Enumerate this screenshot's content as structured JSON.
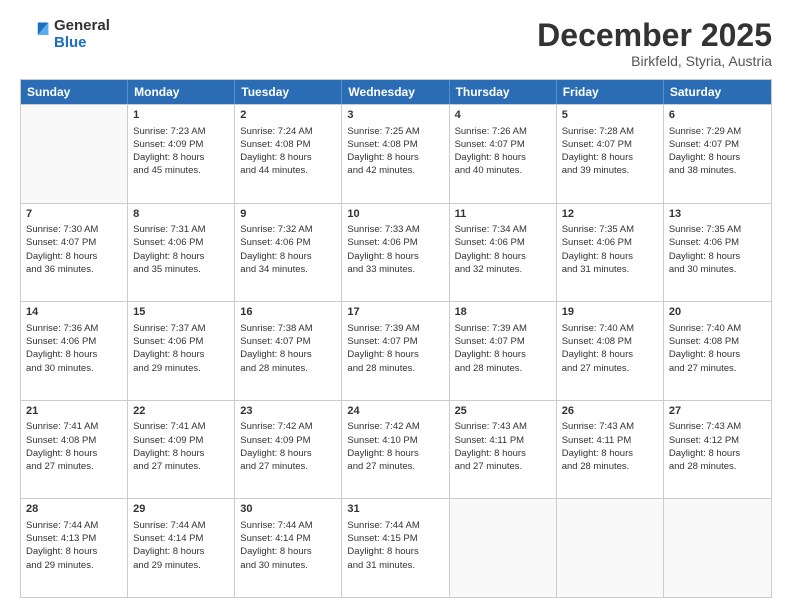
{
  "logo": {
    "general": "General",
    "blue": "Blue"
  },
  "title": "December 2025",
  "subtitle": "Birkfeld, Styria, Austria",
  "days": [
    "Sunday",
    "Monday",
    "Tuesday",
    "Wednesday",
    "Thursday",
    "Friday",
    "Saturday"
  ],
  "weeks": [
    [
      {
        "day": "",
        "lines": []
      },
      {
        "day": "1",
        "lines": [
          "Sunrise: 7:23 AM",
          "Sunset: 4:09 PM",
          "Daylight: 8 hours",
          "and 45 minutes."
        ]
      },
      {
        "day": "2",
        "lines": [
          "Sunrise: 7:24 AM",
          "Sunset: 4:08 PM",
          "Daylight: 8 hours",
          "and 44 minutes."
        ]
      },
      {
        "day": "3",
        "lines": [
          "Sunrise: 7:25 AM",
          "Sunset: 4:08 PM",
          "Daylight: 8 hours",
          "and 42 minutes."
        ]
      },
      {
        "day": "4",
        "lines": [
          "Sunrise: 7:26 AM",
          "Sunset: 4:07 PM",
          "Daylight: 8 hours",
          "and 40 minutes."
        ]
      },
      {
        "day": "5",
        "lines": [
          "Sunrise: 7:28 AM",
          "Sunset: 4:07 PM",
          "Daylight: 8 hours",
          "and 39 minutes."
        ]
      },
      {
        "day": "6",
        "lines": [
          "Sunrise: 7:29 AM",
          "Sunset: 4:07 PM",
          "Daylight: 8 hours",
          "and 38 minutes."
        ]
      }
    ],
    [
      {
        "day": "7",
        "lines": [
          "Sunrise: 7:30 AM",
          "Sunset: 4:07 PM",
          "Daylight: 8 hours",
          "and 36 minutes."
        ]
      },
      {
        "day": "8",
        "lines": [
          "Sunrise: 7:31 AM",
          "Sunset: 4:06 PM",
          "Daylight: 8 hours",
          "and 35 minutes."
        ]
      },
      {
        "day": "9",
        "lines": [
          "Sunrise: 7:32 AM",
          "Sunset: 4:06 PM",
          "Daylight: 8 hours",
          "and 34 minutes."
        ]
      },
      {
        "day": "10",
        "lines": [
          "Sunrise: 7:33 AM",
          "Sunset: 4:06 PM",
          "Daylight: 8 hours",
          "and 33 minutes."
        ]
      },
      {
        "day": "11",
        "lines": [
          "Sunrise: 7:34 AM",
          "Sunset: 4:06 PM",
          "Daylight: 8 hours",
          "and 32 minutes."
        ]
      },
      {
        "day": "12",
        "lines": [
          "Sunrise: 7:35 AM",
          "Sunset: 4:06 PM",
          "Daylight: 8 hours",
          "and 31 minutes."
        ]
      },
      {
        "day": "13",
        "lines": [
          "Sunrise: 7:35 AM",
          "Sunset: 4:06 PM",
          "Daylight: 8 hours",
          "and 30 minutes."
        ]
      }
    ],
    [
      {
        "day": "14",
        "lines": [
          "Sunrise: 7:36 AM",
          "Sunset: 4:06 PM",
          "Daylight: 8 hours",
          "and 30 minutes."
        ]
      },
      {
        "day": "15",
        "lines": [
          "Sunrise: 7:37 AM",
          "Sunset: 4:06 PM",
          "Daylight: 8 hours",
          "and 29 minutes."
        ]
      },
      {
        "day": "16",
        "lines": [
          "Sunrise: 7:38 AM",
          "Sunset: 4:07 PM",
          "Daylight: 8 hours",
          "and 28 minutes."
        ]
      },
      {
        "day": "17",
        "lines": [
          "Sunrise: 7:39 AM",
          "Sunset: 4:07 PM",
          "Daylight: 8 hours",
          "and 28 minutes."
        ]
      },
      {
        "day": "18",
        "lines": [
          "Sunrise: 7:39 AM",
          "Sunset: 4:07 PM",
          "Daylight: 8 hours",
          "and 28 minutes."
        ]
      },
      {
        "day": "19",
        "lines": [
          "Sunrise: 7:40 AM",
          "Sunset: 4:08 PM",
          "Daylight: 8 hours",
          "and 27 minutes."
        ]
      },
      {
        "day": "20",
        "lines": [
          "Sunrise: 7:40 AM",
          "Sunset: 4:08 PM",
          "Daylight: 8 hours",
          "and 27 minutes."
        ]
      }
    ],
    [
      {
        "day": "21",
        "lines": [
          "Sunrise: 7:41 AM",
          "Sunset: 4:08 PM",
          "Daylight: 8 hours",
          "and 27 minutes."
        ]
      },
      {
        "day": "22",
        "lines": [
          "Sunrise: 7:41 AM",
          "Sunset: 4:09 PM",
          "Daylight: 8 hours",
          "and 27 minutes."
        ]
      },
      {
        "day": "23",
        "lines": [
          "Sunrise: 7:42 AM",
          "Sunset: 4:09 PM",
          "Daylight: 8 hours",
          "and 27 minutes."
        ]
      },
      {
        "day": "24",
        "lines": [
          "Sunrise: 7:42 AM",
          "Sunset: 4:10 PM",
          "Daylight: 8 hours",
          "and 27 minutes."
        ]
      },
      {
        "day": "25",
        "lines": [
          "Sunrise: 7:43 AM",
          "Sunset: 4:11 PM",
          "Daylight: 8 hours",
          "and 27 minutes."
        ]
      },
      {
        "day": "26",
        "lines": [
          "Sunrise: 7:43 AM",
          "Sunset: 4:11 PM",
          "Daylight: 8 hours",
          "and 28 minutes."
        ]
      },
      {
        "day": "27",
        "lines": [
          "Sunrise: 7:43 AM",
          "Sunset: 4:12 PM",
          "Daylight: 8 hours",
          "and 28 minutes."
        ]
      }
    ],
    [
      {
        "day": "28",
        "lines": [
          "Sunrise: 7:44 AM",
          "Sunset: 4:13 PM",
          "Daylight: 8 hours",
          "and 29 minutes."
        ]
      },
      {
        "day": "29",
        "lines": [
          "Sunrise: 7:44 AM",
          "Sunset: 4:14 PM",
          "Daylight: 8 hours",
          "and 29 minutes."
        ]
      },
      {
        "day": "30",
        "lines": [
          "Sunrise: 7:44 AM",
          "Sunset: 4:14 PM",
          "Daylight: 8 hours",
          "and 30 minutes."
        ]
      },
      {
        "day": "31",
        "lines": [
          "Sunrise: 7:44 AM",
          "Sunset: 4:15 PM",
          "Daylight: 8 hours",
          "and 31 minutes."
        ]
      },
      {
        "day": "",
        "lines": []
      },
      {
        "day": "",
        "lines": []
      },
      {
        "day": "",
        "lines": []
      }
    ]
  ]
}
